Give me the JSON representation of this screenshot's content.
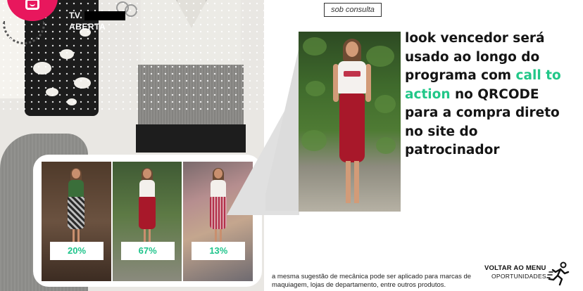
{
  "header": {
    "channel_line1": "TV",
    "channel_line2": "ABERTA"
  },
  "tag": "sob consulta",
  "headline": {
    "part1": "look vencedor será usado ao longo do programa com ",
    "accent": "call to action",
    "part2": " no QRCODE para a compra direto no site do patrocinador"
  },
  "poll": {
    "options": [
      {
        "label": "20%",
        "value": 20
      },
      {
        "label": "67%",
        "value": 67
      },
      {
        "label": "13%",
        "value": 13
      }
    ]
  },
  "footer": {
    "note": "a mesma sugestão de mecânica pode ser aplicado para marcas de maquiagem, lojas de departamento, entre outros produtos.",
    "back_title": "VOLTAR AO MENU",
    "back_subtitle": "OPORTUNIDADES",
    "back_icon": "running-person-icon"
  },
  "colors": {
    "brand": "#e8175d",
    "accent": "#21c788",
    "text": "#141414"
  }
}
